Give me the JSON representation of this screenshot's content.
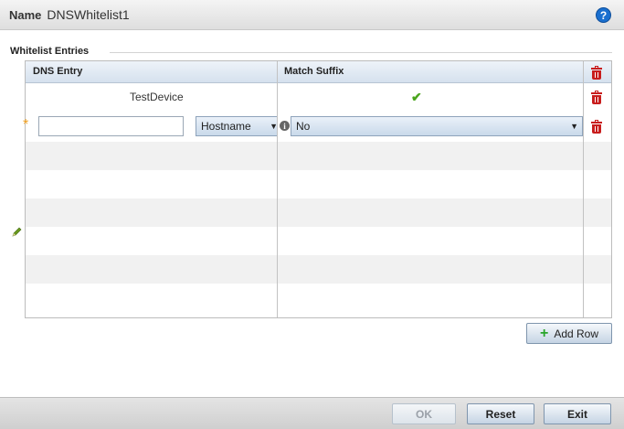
{
  "header": {
    "name_label": "Name",
    "name_value": "DNSWhitelist1",
    "help_icon": "question-circle-icon",
    "help_glyph": "?"
  },
  "section": {
    "legend": "Whitelist Entries"
  },
  "table": {
    "columns": [
      "DNS Entry",
      "Match Suffix"
    ],
    "delete_icon": "trash-icon",
    "rows": [
      {
        "dns_entry": "TestDevice",
        "match_suffix": "checked"
      }
    ],
    "edit_row": {
      "dns_entry_value": "",
      "type_select": "Hostname",
      "match_suffix_select": "No",
      "required_marker": "*",
      "info_glyph": "i"
    }
  },
  "buttons": {
    "add_row": "Add Row",
    "ok": "OK",
    "reset": "Reset",
    "exit": "Exit"
  },
  "colors": {
    "accent_blue": "#1a6fcf",
    "delete_red": "#c81d1d",
    "check_green": "#4aa51c",
    "required_orange": "#f0a020"
  }
}
